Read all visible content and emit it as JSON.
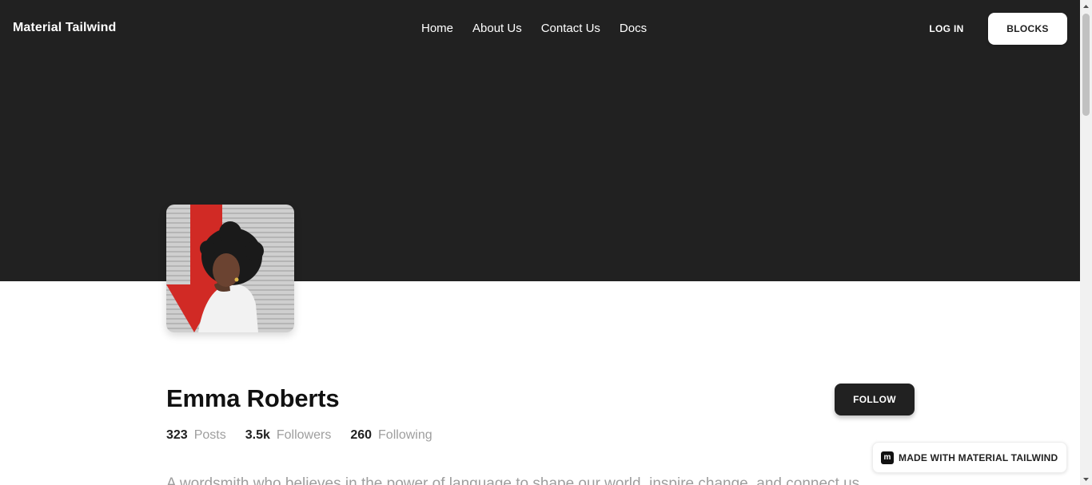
{
  "navbar": {
    "brand": "Material Tailwind",
    "links": [
      "Home",
      "About Us",
      "Contact Us",
      "Docs"
    ],
    "login_label": "LOG IN",
    "blocks_label": "BLOCKS"
  },
  "profile": {
    "name": "Emma Roberts",
    "follow_label": "FOLLOW",
    "stats": [
      {
        "value": "323",
        "label": "Posts"
      },
      {
        "value": "3.5k",
        "label": "Followers"
      },
      {
        "value": "260",
        "label": "Following"
      }
    ],
    "bio": "A wordsmith who believes in the power of language to shape our world, inspire change, and connect us"
  },
  "badge": {
    "logo_letter": "m",
    "text": "MADE WITH MATERIAL TAILWIND"
  },
  "colors": {
    "hero_bg": "#212121",
    "button_dark": "#212121",
    "muted_text": "#9e9e9e"
  },
  "icons": {
    "avatar": "profile-photo",
    "badge_logo": "material-tailwind-logo"
  }
}
